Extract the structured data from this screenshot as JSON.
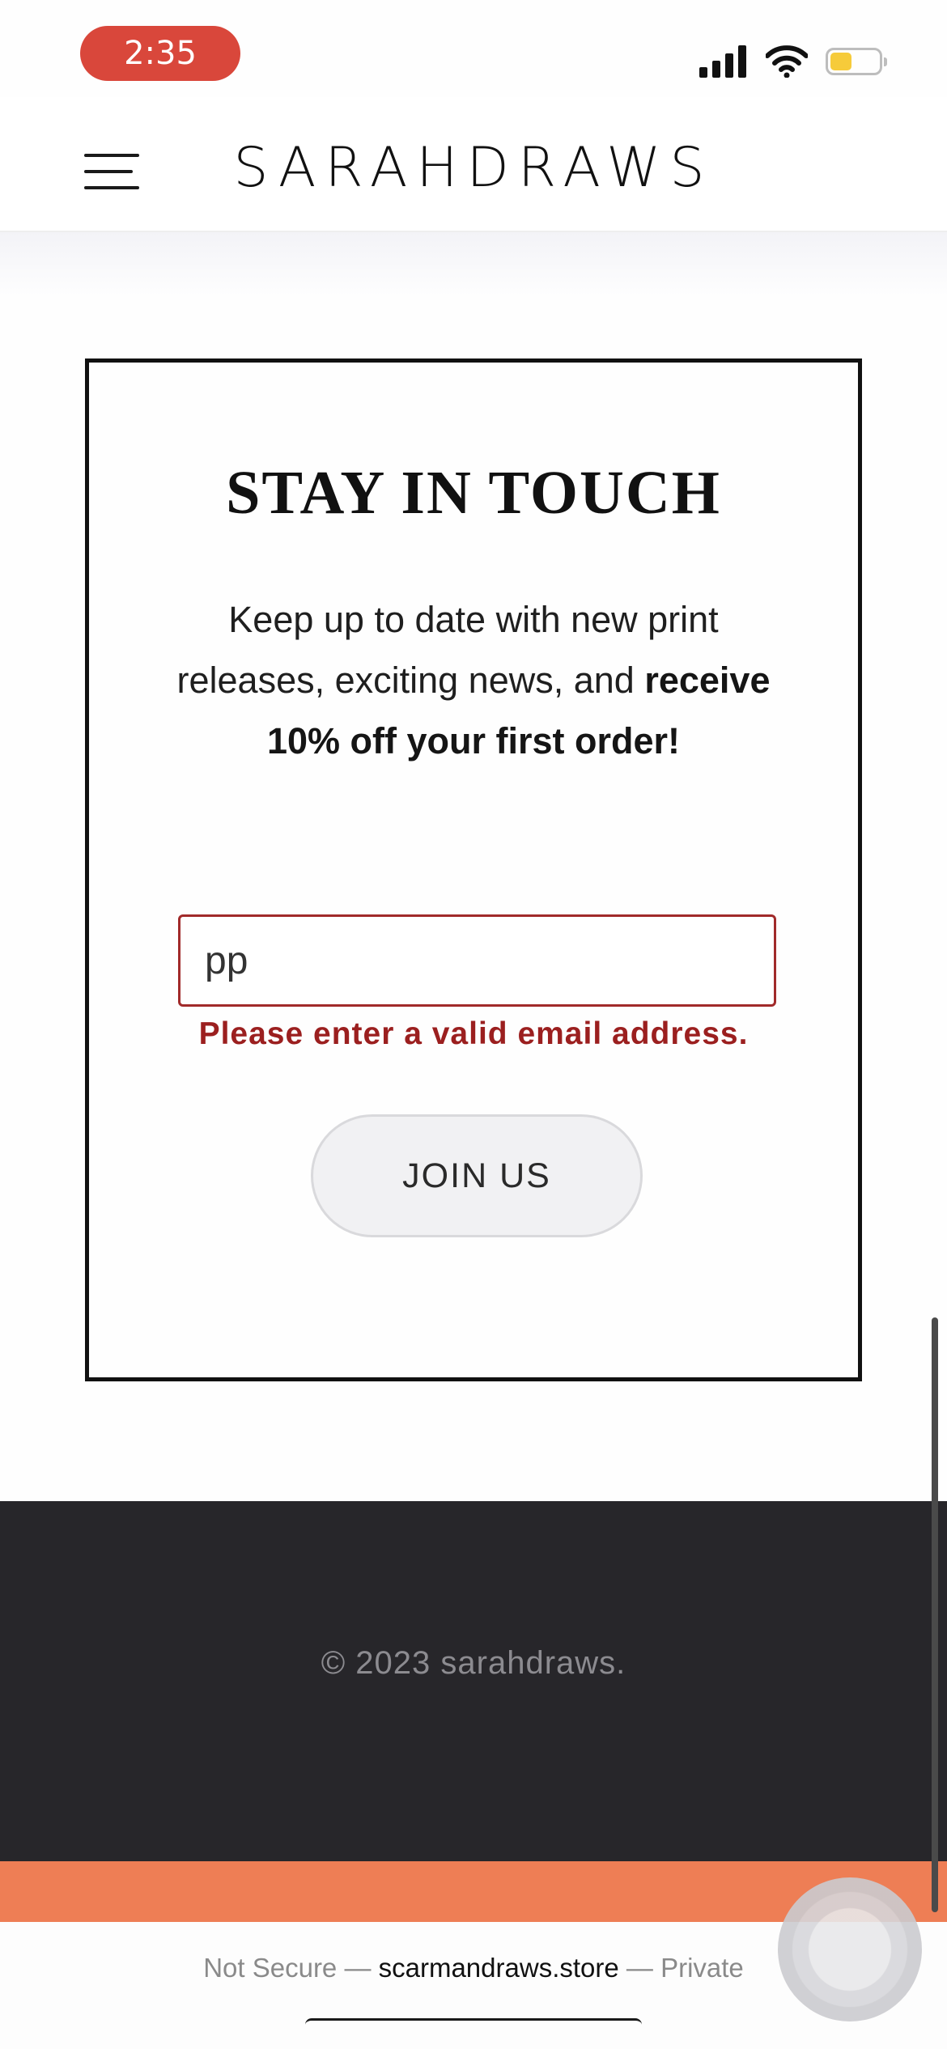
{
  "status_bar": {
    "time": "2:35",
    "icons": [
      "signal-icon",
      "wifi-icon",
      "battery-icon"
    ],
    "battery_color": "#f6cb3a"
  },
  "header": {
    "brand": "SARAHDRAWS",
    "menu_icon": "hamburger-menu-icon"
  },
  "newsletter": {
    "title": "STAY IN TOUCH",
    "text_regular": "Keep up to date with new print releases, exciting news, and ",
    "text_strong": "receive 10% off your first order!",
    "email_value": "pp",
    "error": "Please enter a valid email address.",
    "error_color": "#9b1f1f",
    "button_label": "JOIN US"
  },
  "footer": {
    "copyright": "© 2023 sarahdraws.",
    "background": "#27262a",
    "accent_color": "#ee7e55"
  },
  "browser": {
    "prefix": "Not Secure — ",
    "domain": "scarmandraws.store",
    "suffix": " — Private"
  }
}
